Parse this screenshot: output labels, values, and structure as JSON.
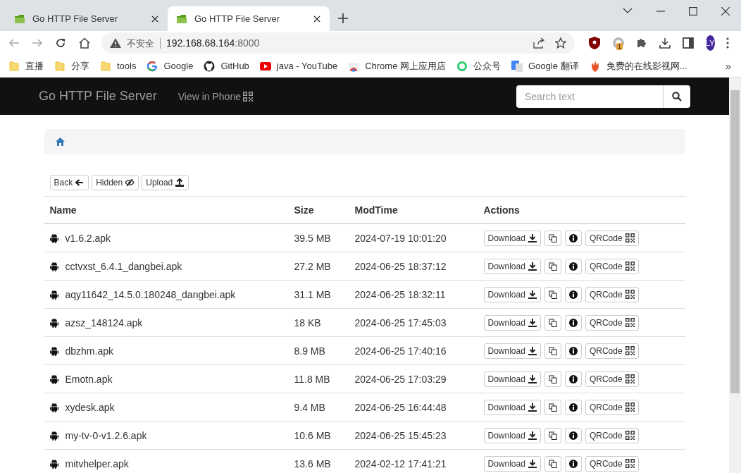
{
  "browser": {
    "tabs": [
      {
        "title": "Go HTTP File Server",
        "selected": false
      },
      {
        "title": "Go HTTP File Server",
        "selected": true
      }
    ],
    "address": {
      "security": "不安全",
      "host": "192.168.68.164",
      "port": ":8000"
    },
    "extension_badge": "1",
    "profile": "LY",
    "bookmarks": [
      {
        "kind": "folder",
        "label": "直播"
      },
      {
        "kind": "folder",
        "label": "分享"
      },
      {
        "kind": "folder",
        "label": "tools"
      },
      {
        "kind": "google",
        "label": "Google"
      },
      {
        "kind": "github",
        "label": "GitHub"
      },
      {
        "kind": "youtube",
        "label": "java - YouTube"
      },
      {
        "kind": "webstore",
        "label": "Chrome 网上应用店"
      },
      {
        "kind": "ring",
        "label": "公众号"
      },
      {
        "kind": "translate",
        "label": "Google 翻译"
      },
      {
        "kind": "flame",
        "label": "免费的在线影视网..."
      }
    ],
    "bookmarks_overflow": "»"
  },
  "navbar": {
    "brand": "Go HTTP File Server",
    "link": "View in Phone",
    "search": {
      "placeholder": "Search text"
    }
  },
  "toolbar": [
    {
      "kind": "back",
      "label": "Back"
    },
    {
      "kind": "hidden",
      "label": "Hidden"
    },
    {
      "kind": "upload",
      "label": "Upload"
    }
  ],
  "table": {
    "columns": [
      "Name",
      "Size",
      "ModTime",
      "Actions"
    ],
    "rows": [
      {
        "name": "v1.6.2.apk",
        "size": "39.5 MB",
        "modtime": "2024-07-19 10:01:20",
        "download": "Download",
        "qrcode": "QRCode"
      },
      {
        "name": "cctvxst_6.4.1_dangbei.apk",
        "size": "27.2 MB",
        "modtime": "2024-06-25 18:37:12",
        "download": "Download",
        "qrcode": "QRCode"
      },
      {
        "name": "aqy11642_14.5.0.180248_dangbei.apk",
        "size": "31.1 MB",
        "modtime": "2024-06-25 18:32:11",
        "download": "Download",
        "qrcode": "QRCode"
      },
      {
        "name": "azsz_148124.apk",
        "size": "18 KB",
        "modtime": "2024-06-25 17:45:03",
        "download": "Download",
        "qrcode": "QRCode"
      },
      {
        "name": "dbzhm.apk",
        "size": "8.9 MB",
        "modtime": "2024-06-25 17:40:16",
        "download": "Download",
        "qrcode": "QRCode"
      },
      {
        "name": "Emotn.apk",
        "size": "11.8 MB",
        "modtime": "2024-06-25 17:03:29",
        "download": "Download",
        "qrcode": "QRCode"
      },
      {
        "name": "xydesk.apk",
        "size": "9.4 MB",
        "modtime": "2024-06-25 16:44:48",
        "download": "Download",
        "qrcode": "QRCode"
      },
      {
        "name": "my-tv-0-v1.2.6.apk",
        "size": "10.6 MB",
        "modtime": "2024-06-25 15:45:23",
        "download": "Download",
        "qrcode": "QRCode"
      },
      {
        "name": "mitvhelper.apk",
        "size": "13.6 MB",
        "modtime": "2024-02-12 17:41:21",
        "download": "Download",
        "qrcode": "QRCode"
      }
    ]
  }
}
